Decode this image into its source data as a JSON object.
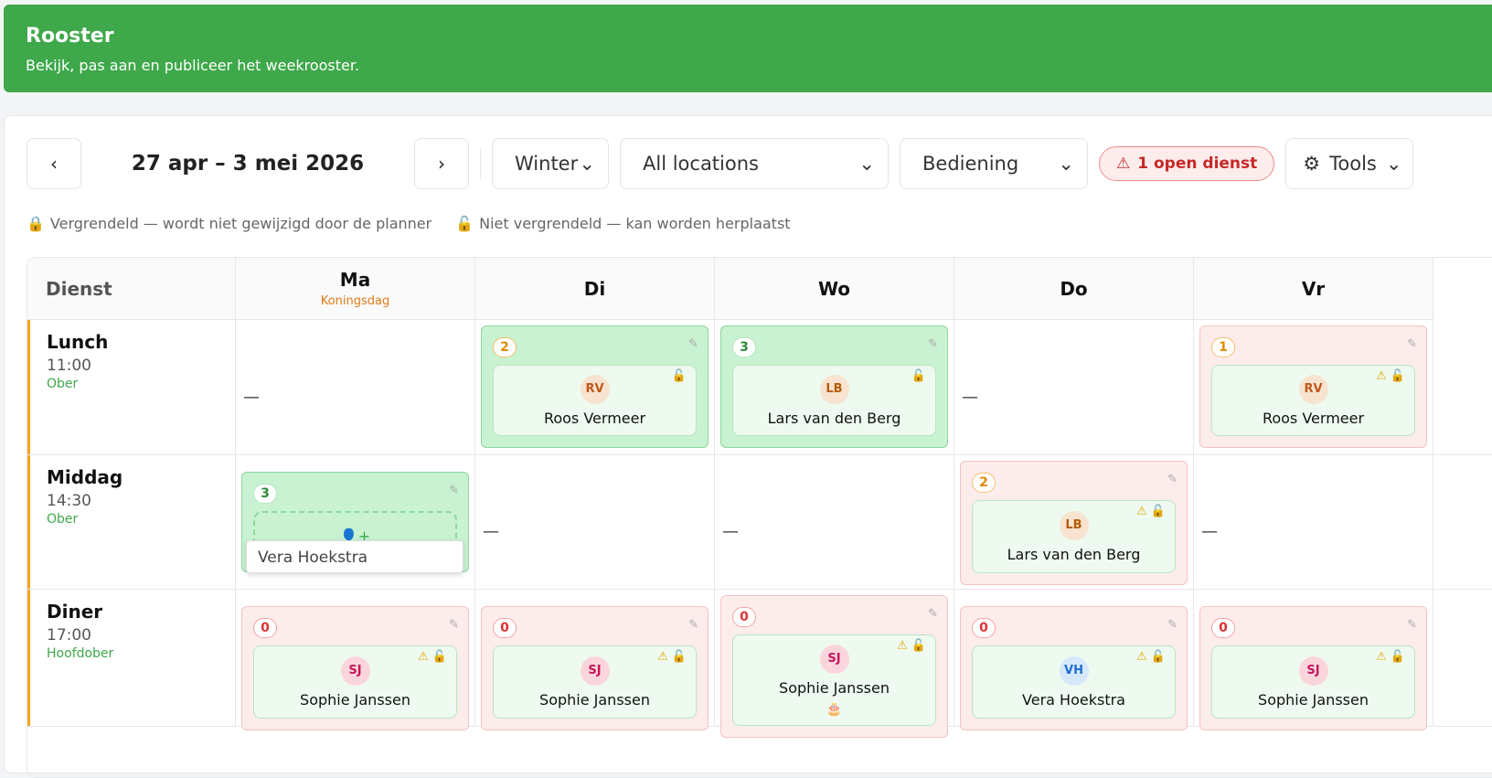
{
  "header": {
    "title": "Rooster",
    "subtitle": "Bekijk, pas aan en publiceer het weekrooster."
  },
  "toolbar": {
    "prev_icon": "chevron-left-icon",
    "next_icon": "chevron-right-icon",
    "date_range": "27 apr – 3 mei 2026",
    "season": "Winter",
    "location": "All locations",
    "department": "Bediening",
    "open_badge": "1 open dienst",
    "tools": "Tools"
  },
  "legend": {
    "locked": "Vergrendeld — wordt niet gewijzigd door de planner",
    "unlocked": "Niet vergrendeld — kan worden herplaatst"
  },
  "table": {
    "header": "Dienst",
    "days": [
      {
        "name": "Ma",
        "holiday": "Koningsdag"
      },
      {
        "name": "Di",
        "holiday": ""
      },
      {
        "name": "Wo",
        "holiday": ""
      },
      {
        "name": "Do",
        "holiday": ""
      },
      {
        "name": "Vr",
        "holiday": ""
      }
    ],
    "rows": [
      {
        "name": "Lunch",
        "time": "11:00",
        "role": "Ober",
        "cells": [
          {
            "empty": true
          },
          {
            "count": "2",
            "cc": "orange",
            "color": "green",
            "initials": "RV",
            "ac": "rv",
            "employee": "Roos Vermeer",
            "warn": false
          },
          {
            "count": "3",
            "cc": "green",
            "color": "green",
            "initials": "LB",
            "ac": "lb",
            "employee": "Lars van den Berg",
            "warn": false
          },
          {
            "empty": true
          },
          {
            "count": "1",
            "cc": "orange",
            "color": "red",
            "initials": "RV",
            "ac": "rv",
            "employee": "Roos Vermeer",
            "warn": true
          }
        ]
      },
      {
        "name": "Middag",
        "time": "14:30",
        "role": "Ober",
        "cells": [
          {
            "add": true,
            "count": "3",
            "cc": "green",
            "color": "green",
            "popup": "Vera Hoekstra"
          },
          {
            "empty": true
          },
          {
            "empty": true
          },
          {
            "count": "2",
            "cc": "orange",
            "color": "red",
            "initials": "LB",
            "ac": "lb",
            "employee": "Lars van den Berg",
            "warn": true
          },
          {
            "empty": true
          }
        ]
      },
      {
        "name": "Diner",
        "time": "17:00",
        "role": "Hoofdober",
        "cells": [
          {
            "count": "0",
            "cc": "red",
            "color": "red",
            "initials": "SJ",
            "ac": "sj",
            "employee": "Sophie Janssen",
            "warn": true
          },
          {
            "count": "0",
            "cc": "red",
            "color": "red",
            "initials": "SJ",
            "ac": "sj",
            "employee": "Sophie Janssen",
            "warn": true
          },
          {
            "count": "0",
            "cc": "red",
            "color": "red",
            "initials": "SJ",
            "ac": "sj",
            "employee": "Sophie Janssen",
            "warn": true,
            "cake": true
          },
          {
            "count": "0",
            "cc": "red",
            "color": "red",
            "initials": "VH",
            "ac": "vh",
            "employee": "Vera Hoekstra",
            "warn": true
          },
          {
            "count": "0",
            "cc": "red",
            "color": "red",
            "initials": "SJ",
            "ac": "sj",
            "employee": "Sophie Janssen",
            "warn": true
          }
        ]
      }
    ]
  },
  "icons": {
    "empty_dash": "—",
    "pencil": "✎",
    "lock": "🔓",
    "warning": "⚠",
    "cake": "🎂"
  }
}
